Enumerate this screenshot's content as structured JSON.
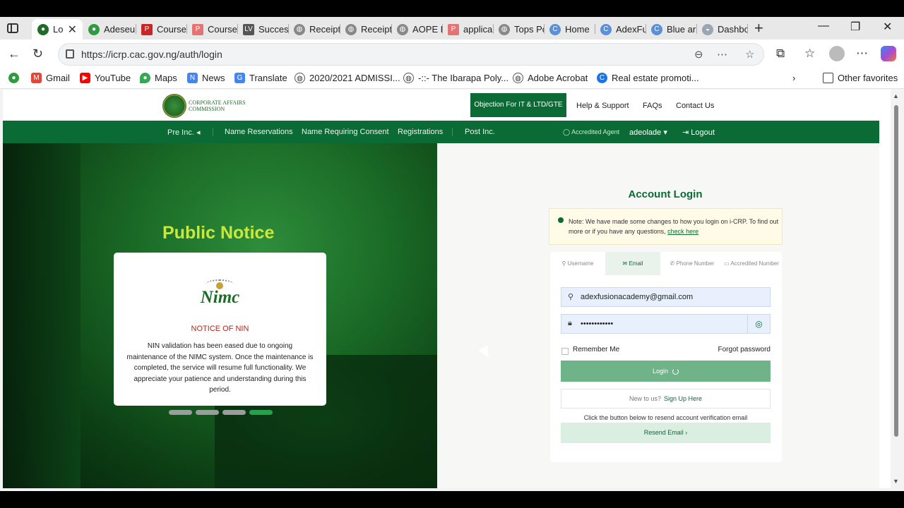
{
  "browser": {
    "tabs": [
      {
        "label": "Lo",
        "icon": "cac-icon",
        "active": true
      },
      {
        "label": "Adeseu",
        "icon": "cac-icon"
      },
      {
        "label": "Course",
        "icon": "pdf-icon"
      },
      {
        "label": "Course",
        "icon": "pdf-icon"
      },
      {
        "label": "Succes",
        "icon": "lv-icon"
      },
      {
        "label": "Receipt",
        "icon": "globe-icon"
      },
      {
        "label": "Receipt",
        "icon": "globe-icon"
      },
      {
        "label": "AOPE F",
        "icon": "globe-icon"
      },
      {
        "label": "applica",
        "icon": "pdf-icon"
      },
      {
        "label": "Tops Po",
        "icon": "globe-icon"
      },
      {
        "label": "Home",
        "icon": "edge-c-icon"
      },
      {
        "label": "AdexFu",
        "icon": "edge-c-icon"
      },
      {
        "label": "Blue ar",
        "icon": "edge-c-icon"
      },
      {
        "label": "Dashbc",
        "icon": "dashboard-icon"
      }
    ],
    "url": "https://icrp.cac.gov.ng/auth/login",
    "bookmarks": [
      {
        "label": "Gmail",
        "icon": "gmail-icon",
        "color": "#ea4335"
      },
      {
        "label": "YouTube",
        "icon": "youtube-icon",
        "color": "#ff0000"
      },
      {
        "label": "Maps",
        "icon": "maps-icon",
        "color": "#34a853"
      },
      {
        "label": "News",
        "icon": "news-icon",
        "color": "#4285f4"
      },
      {
        "label": "Translate",
        "icon": "translate-icon",
        "color": "#4285f4"
      },
      {
        "label": "2020/2021 ADMISSI...",
        "icon": "globe-icon",
        "color": "#555555"
      },
      {
        "label": "-::- The Ibarapa Poly...",
        "icon": "globe-icon",
        "color": "#555555"
      },
      {
        "label": "Adobe Acrobat",
        "icon": "globe-icon",
        "color": "#555555"
      },
      {
        "label": "Real estate promoti...",
        "icon": "edge-c-icon",
        "color": "#1a73e8"
      }
    ],
    "other_favorites": "Other favorites"
  },
  "site": {
    "logo_text_line1": "CORPORATE AFFAIRS",
    "logo_text_line2": "COMMISSION",
    "objection_btn": "Objection For IT & LTD/GTE",
    "top_links": [
      "Help & Support",
      "FAQs",
      "Contact Us"
    ],
    "nav": [
      "Pre Inc.",
      "Name Reservations",
      "Name Requiring Consent",
      "Registrations",
      "Post Inc."
    ],
    "accredited_agent": "Accredited Agent",
    "user": "adeolade",
    "logout": "Logout",
    "brand_green": "#0a6b35"
  },
  "hero": {
    "title": "Public Notice",
    "card_logo": "Nimc",
    "card_heading": "NOTICE OF NIN",
    "card_body": "NIN validation has been eased due to ongoing maintenance of the NIMC system. Once the maintenance is completed, the service will resume full functionality. We appreciate your patience and understanding during this period.",
    "active_slide": 4,
    "slides": 4
  },
  "login": {
    "title": "Account Login",
    "note": "Note: We have made some changes to how you login on i-CRP. To find out more or if you have any questions,",
    "note_link": "check here",
    "tabs": [
      "Username",
      "Email",
      "Phone Number",
      "Accredited Number"
    ],
    "selected_tab": "Email",
    "email_value": "adexfusionacademy@gmail.com",
    "password_value": "••••••••••••",
    "remember_me": "Remember Me",
    "forgot_password": "Forgot password",
    "login_btn": "Login",
    "new_to_us": "New to us?",
    "sign_up": "Sign Up Here",
    "resend_text": "Click the button below to resend account verification email",
    "resend_btn": "Resend Email"
  }
}
